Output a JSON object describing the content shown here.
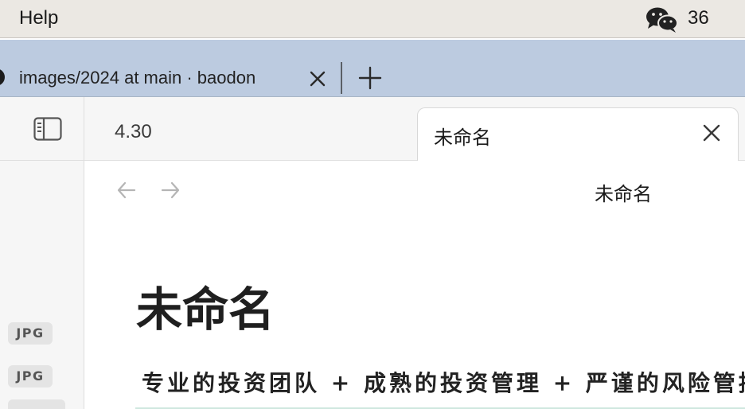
{
  "menubar": {
    "help_label": "Help",
    "wechat_icon": "wechat-icon",
    "wechat_count": "36"
  },
  "browser": {
    "tab": {
      "title": "images/2024 at main · baodon",
      "icon": "github-icon"
    },
    "new_tab_icon": "plus-icon"
  },
  "app": {
    "sidebar_toggle_icon": "sidebar-icon",
    "tabs": [
      {
        "label": "4.30",
        "active": false
      },
      {
        "label": "未命名",
        "active": true
      }
    ],
    "sidebar": {
      "badges": [
        "JPG",
        "JPG"
      ]
    },
    "editor": {
      "view_title": "未命名",
      "note_title": "未命名",
      "image_text": "专业的投资团队 + 成熟的投资管理 + 严谨的风险管控"
    }
  },
  "colors": {
    "menubar_bg": "#ebe8e3",
    "tabstrip_bg": "#bccbe0",
    "sidebar_bg": "#f6f6f6"
  }
}
